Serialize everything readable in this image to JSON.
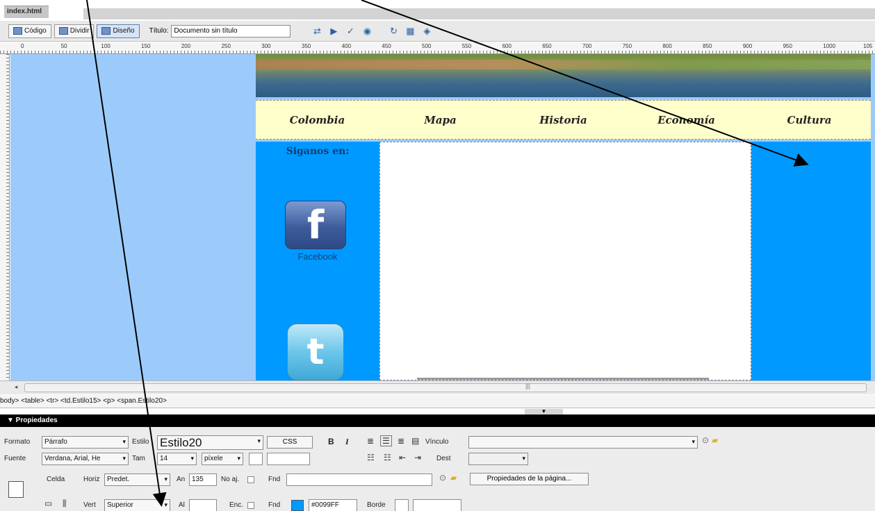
{
  "file_tab": "index.html",
  "toolbar": {
    "code_label": "Código",
    "split_label": "Dividir",
    "design_label": "Diseño",
    "title_label": "Título:",
    "title_value": "Documento sin título"
  },
  "ruler": {
    "marks": [
      "0",
      "50",
      "100",
      "150",
      "200",
      "250",
      "300",
      "350",
      "400",
      "450",
      "500",
      "550",
      "600",
      "650",
      "700",
      "750",
      "800",
      "850",
      "900",
      "950",
      "1000",
      "105"
    ]
  },
  "page": {
    "nav": [
      "Colombia",
      "Mapa",
      "Historia",
      "Economía",
      "Cultura"
    ],
    "follow_text": "Siganos en:",
    "facebook_label": "Facebook",
    "facebook_glyph": "f",
    "twitter_glyph": "t"
  },
  "tag_selector": "body> <table> <tr> <td.Estilo15> <p> <span.Estilo20>",
  "properties": {
    "header": "▼ Propiedades",
    "format_label": "Formato",
    "format_value": "Párrafo",
    "style_label": "Estilo",
    "style_value": "Estilo20",
    "css_button": "CSS",
    "bold": "B",
    "italic": "I",
    "link_label": "Vínculo",
    "font_label": "Fuente",
    "font_value": "Verdana, Arial, He",
    "size_label": "Tam",
    "size_value": "14",
    "unit_value": "píxele",
    "target_label": "Dest",
    "cell_label": "Celda",
    "horz_label": "Horiz",
    "horz_value": "Predet.",
    "width_label": "An",
    "width_value": "135",
    "nowrap_label": "No aj.",
    "bg_label": "Fnd",
    "page_props_button": "Propiedades de la página...",
    "vert_label": "Vert",
    "vert_value": "Superior",
    "height_label": "Al",
    "header_label": "Enc.",
    "bg_label2": "Fnd",
    "bg_color": "#0099FF",
    "border_label": "Borde"
  },
  "colors": {
    "canvas_bg": "#9CCBFB",
    "column_blue": "#0099FF",
    "nav_bg": "#FFFFCC"
  }
}
